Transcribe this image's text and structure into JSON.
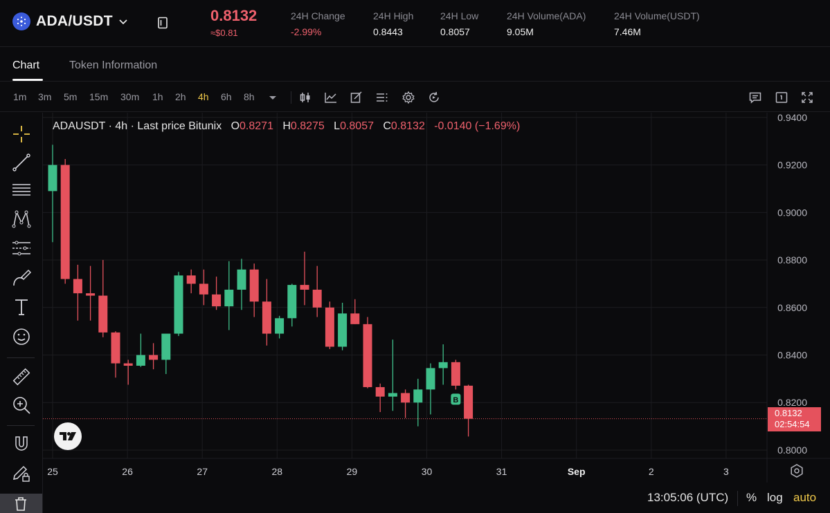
{
  "header": {
    "pair": "ADA/USDT",
    "last_price": "0.8132",
    "last_price_fiat": "≈$0.81",
    "stats": [
      {
        "label": "24H Change",
        "value": "-2.99%",
        "negative": true
      },
      {
        "label": "24H High",
        "value": "0.8443",
        "negative": false
      },
      {
        "label": "24H Low",
        "value": "0.8057",
        "negative": false
      },
      {
        "label": "24H Volume(ADA)",
        "value": "9.05M",
        "negative": false
      },
      {
        "label": "24H Volume(USDT)",
        "value": "7.46M",
        "negative": false
      }
    ]
  },
  "tabs": [
    "Chart",
    "Token Information"
  ],
  "active_tab": "Chart",
  "toolbar": {
    "timeframes": [
      "1m",
      "3m",
      "5m",
      "15m",
      "30m",
      "1h",
      "2h",
      "4h",
      "6h",
      "8h"
    ],
    "active_timeframe": "4h",
    "icons": [
      "more-timeframes-chevron-icon",
      "candle-type-icon",
      "indicators-icon",
      "drawing-icon",
      "templates-icon",
      "settings-gear-icon",
      "replay-icon",
      "chat-icon",
      "single-layout-icon",
      "fullscreen-icon"
    ]
  },
  "left_tools": [
    "crosshair-icon",
    "trend-line-icon",
    "fib-retracement-icon",
    "pattern-icon",
    "prediction-icon",
    "brush-icon",
    "text-icon",
    "emoji-icon",
    "ruler-icon",
    "zoom-in-icon",
    "magnet-icon",
    "lock-pencil-icon",
    "trash-icon"
  ],
  "legend": {
    "symbol": "ADAUSDT · 4h · Last price Bitunix",
    "o_label": "O",
    "o_value": "0.8271",
    "h_label": "H",
    "h_value": "0.8275",
    "l_label": "L",
    "l_value": "0.8057",
    "c_label": "C",
    "c_value": "0.8132",
    "change": "-0.0140 (−1.69%)"
  },
  "price_tag": {
    "price": "0.8132",
    "countdown": "02:54:54"
  },
  "footer": {
    "time": "13:05:06 (UTC)",
    "percent": "%",
    "log": "log",
    "auto": "auto"
  },
  "colors": {
    "up": "#3fbf8a",
    "down": "#e5525d",
    "accent": "#f0c94a",
    "background": "#0b0b0d"
  },
  "chart_data": {
    "type": "candlestick",
    "title": "ADAUSDT · 4h · Last price Bitunix",
    "y_tick_labels": [
      "0.9400",
      "0.9200",
      "0.9000",
      "0.8800",
      "0.8600",
      "0.8400",
      "0.8200",
      "0.8000"
    ],
    "x_tick_labels": [
      "25",
      "26",
      "27",
      "28",
      "29",
      "30",
      "31",
      "Sep",
      "2",
      "3"
    ],
    "ylim": [
      0.7965,
      0.942
    ],
    "last_price_line": 0.8132,
    "marker": {
      "index": 32,
      "label": "B"
    },
    "candles": [
      {
        "o": 0.909,
        "h": 0.9285,
        "l": 0.8875,
        "c": 0.92
      },
      {
        "o": 0.92,
        "h": 0.9225,
        "l": 0.87,
        "c": 0.872
      },
      {
        "o": 0.872,
        "h": 0.878,
        "l": 0.8545,
        "c": 0.866
      },
      {
        "o": 0.866,
        "h": 0.8775,
        "l": 0.8545,
        "c": 0.865
      },
      {
        "o": 0.865,
        "h": 0.88,
        "l": 0.8475,
        "c": 0.8495
      },
      {
        "o": 0.8495,
        "h": 0.85,
        "l": 0.8305,
        "c": 0.8365
      },
      {
        "o": 0.8365,
        "h": 0.838,
        "l": 0.8275,
        "c": 0.8355
      },
      {
        "o": 0.8355,
        "h": 0.849,
        "l": 0.835,
        "c": 0.84
      },
      {
        "o": 0.84,
        "h": 0.845,
        "l": 0.834,
        "c": 0.838
      },
      {
        "o": 0.838,
        "h": 0.847,
        "l": 0.832,
        "c": 0.849
      },
      {
        "o": 0.849,
        "h": 0.875,
        "l": 0.848,
        "c": 0.8735
      },
      {
        "o": 0.8735,
        "h": 0.876,
        "l": 0.866,
        "c": 0.87
      },
      {
        "o": 0.87,
        "h": 0.876,
        "l": 0.861,
        "c": 0.8655
      },
      {
        "o": 0.8655,
        "h": 0.873,
        "l": 0.859,
        "c": 0.8605
      },
      {
        "o": 0.8605,
        "h": 0.8795,
        "l": 0.8505,
        "c": 0.8675
      },
      {
        "o": 0.8675,
        "h": 0.8805,
        "l": 0.859,
        "c": 0.876
      },
      {
        "o": 0.876,
        "h": 0.8785,
        "l": 0.856,
        "c": 0.8625
      },
      {
        "o": 0.8625,
        "h": 0.872,
        "l": 0.844,
        "c": 0.849
      },
      {
        "o": 0.849,
        "h": 0.8565,
        "l": 0.847,
        "c": 0.8555
      },
      {
        "o": 0.8555,
        "h": 0.87,
        "l": 0.852,
        "c": 0.8695
      },
      {
        "o": 0.8695,
        "h": 0.8835,
        "l": 0.861,
        "c": 0.8675
      },
      {
        "o": 0.8675,
        "h": 0.8775,
        "l": 0.856,
        "c": 0.86
      },
      {
        "o": 0.86,
        "h": 0.8625,
        "l": 0.8425,
        "c": 0.8435
      },
      {
        "o": 0.8435,
        "h": 0.862,
        "l": 0.842,
        "c": 0.8575
      },
      {
        "o": 0.8575,
        "h": 0.8635,
        "l": 0.853,
        "c": 0.853
      },
      {
        "o": 0.853,
        "h": 0.856,
        "l": 0.826,
        "c": 0.8265
      },
      {
        "o": 0.8265,
        "h": 0.828,
        "l": 0.816,
        "c": 0.8225
      },
      {
        "o": 0.8225,
        "h": 0.8465,
        "l": 0.8165,
        "c": 0.824
      },
      {
        "o": 0.824,
        "h": 0.8255,
        "l": 0.8135,
        "c": 0.82
      },
      {
        "o": 0.82,
        "h": 0.83,
        "l": 0.81,
        "c": 0.8255
      },
      {
        "o": 0.8255,
        "h": 0.8365,
        "l": 0.815,
        "c": 0.8345
      },
      {
        "o": 0.8345,
        "h": 0.8445,
        "l": 0.8275,
        "c": 0.837
      },
      {
        "o": 0.837,
        "h": 0.838,
        "l": 0.8255,
        "c": 0.8271
      },
      {
        "o": 0.8271,
        "h": 0.8275,
        "l": 0.8057,
        "c": 0.8132
      }
    ]
  }
}
